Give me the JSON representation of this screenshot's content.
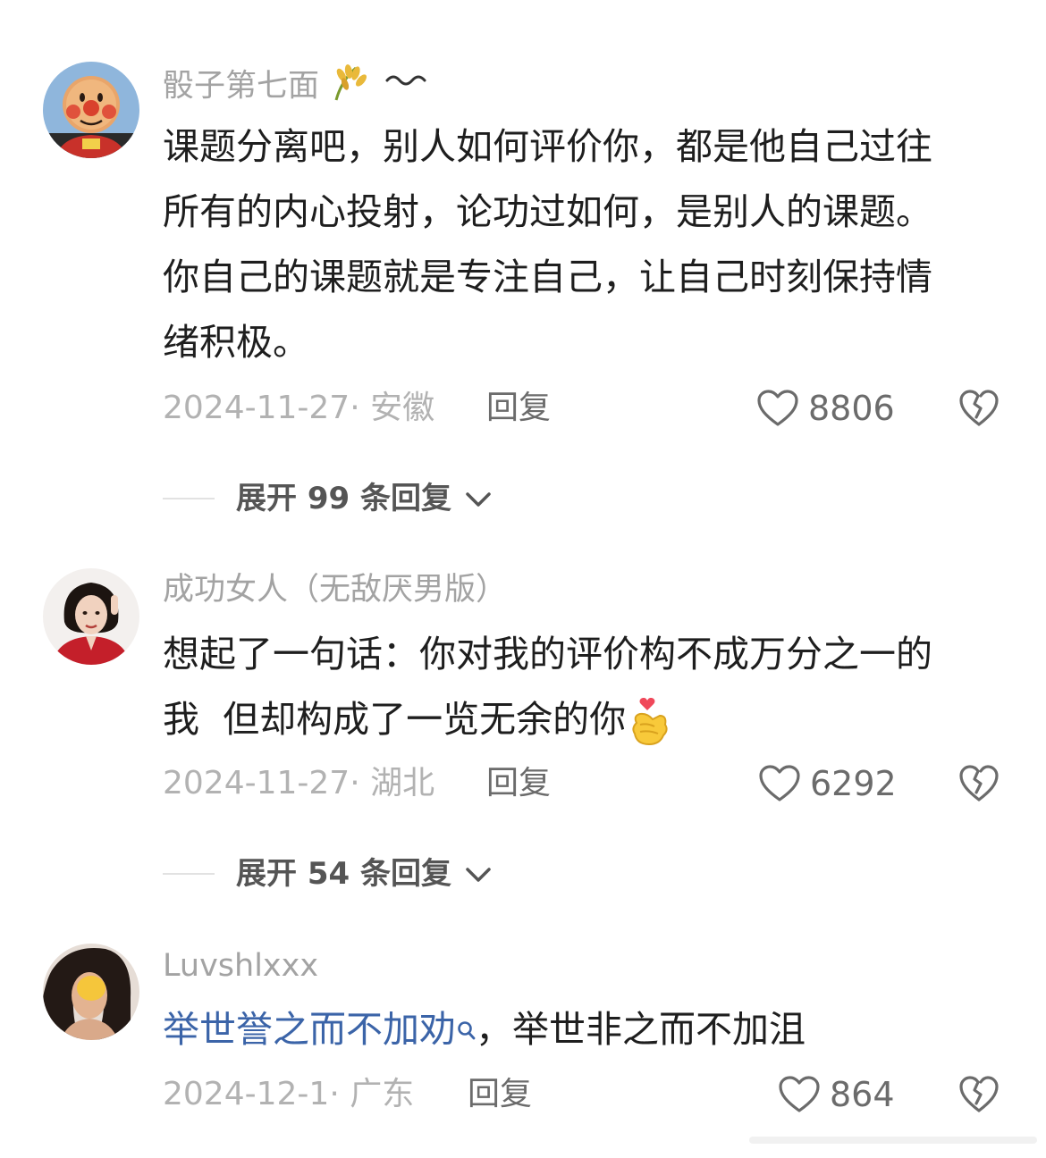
{
  "comments": [
    {
      "username": "骰子第七面",
      "username_icons": [
        "rice-icon",
        "wave-icon"
      ],
      "content_lines": [
        "课题分离吧，别人如何评价你，都是他自己过往",
        "所有的内心投射，论功过如何，是别人的课题。",
        "你自己的课题就是专注自己，让自己时刻保持情",
        "绪积极。"
      ],
      "date": "2024-11-27",
      "location": "安徽",
      "reply_label": "回复",
      "likes": "8806",
      "expand_label": "展开 99 条回复"
    },
    {
      "username": "成功女人（无敌厌男版）",
      "content_lines": [
        "想起了一句话：你对我的评价构不成万分之一的",
        "我  但却构成了一览无余的你"
      ],
      "emoji": "heart-hands-emoji",
      "date": "2024-11-27",
      "location": "湖北",
      "reply_label": "回复",
      "likes": "6292",
      "expand_label": "展开 54 条回复"
    },
    {
      "username": "Luvshlxxx",
      "content_link": "举世誉之而不加劝",
      "content_rest": "，举世非之而不加沮",
      "date": "2024-12-1",
      "location": "广东",
      "reply_label": "回复",
      "likes": "864"
    }
  ],
  "meta_separator": "· ",
  "icons": {
    "like": "heart-outline-icon",
    "dislike": "broken-heart-icon",
    "expand": "chevron-down-icon",
    "search": "search-icon"
  },
  "colors": {
    "text": "#1e1e1e",
    "muted": "#a3a3a3",
    "link": "#3b64a8",
    "action": "#6b6b6b"
  }
}
